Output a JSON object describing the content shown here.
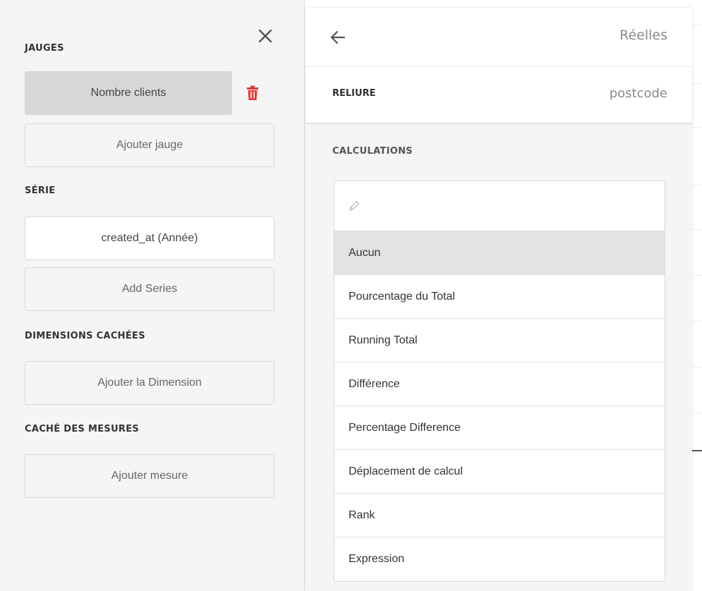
{
  "left_panel": {
    "sections": {
      "gauges": "JAUGES",
      "series": "SÉRIE",
      "hidden_dimensions": "DIMENSIONS CACHÉES",
      "hidden_measures": "CACHÉ DES MESURES"
    },
    "gauge_item": "Nombre clients",
    "add_gauge": "Ajouter jauge",
    "series_item": "created_at (Année)",
    "add_series": "Add Series",
    "add_dimension": "Ajouter la Dimension",
    "add_measure": "Ajouter mesure",
    "icons": {
      "close": "close-icon",
      "trash": "trash-icon"
    },
    "colors": {
      "trash": "#e53935",
      "selected_bg": "#d7d7d7"
    }
  },
  "right_panel": {
    "title": "Réelles",
    "binding_label": "RELIURE",
    "binding_value": "postcode",
    "calculations_label": "CALCULATIONS",
    "calculations": [
      "Aucun",
      "Pourcentage du Total",
      "Running Total",
      "Différence",
      "Percentage Difference",
      "Déplacement de calcul",
      "Rank",
      "Expression"
    ],
    "selected_calculation": "Aucun",
    "icons": {
      "back": "arrow-left-icon",
      "edit": "pencil-icon"
    }
  }
}
